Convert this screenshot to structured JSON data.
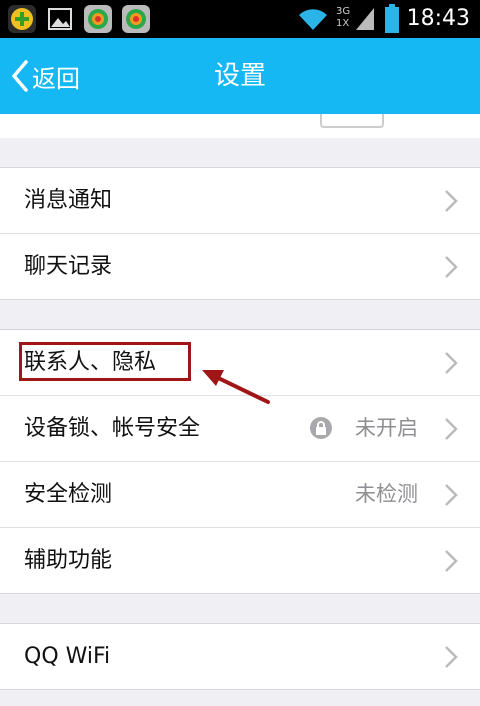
{
  "status_bar": {
    "time": "18:43",
    "network": "3G 1X"
  },
  "nav": {
    "back_label": "返回",
    "title": "设置"
  },
  "groups": [
    {
      "items": [
        {
          "label": "消息通知"
        },
        {
          "label": "聊天记录"
        }
      ]
    },
    {
      "items": [
        {
          "label": "联系人、隐私"
        },
        {
          "label": "设备锁、帐号安全",
          "value": "未开启"
        },
        {
          "label": "安全检测",
          "value": "未检测"
        },
        {
          "label": "辅助功能"
        }
      ]
    },
    {
      "items": [
        {
          "label": "QQ WiFi"
        }
      ]
    }
  ],
  "annotation": {
    "highlight_color": "#a01515"
  },
  "colors": {
    "accent": "#16b8f3"
  }
}
